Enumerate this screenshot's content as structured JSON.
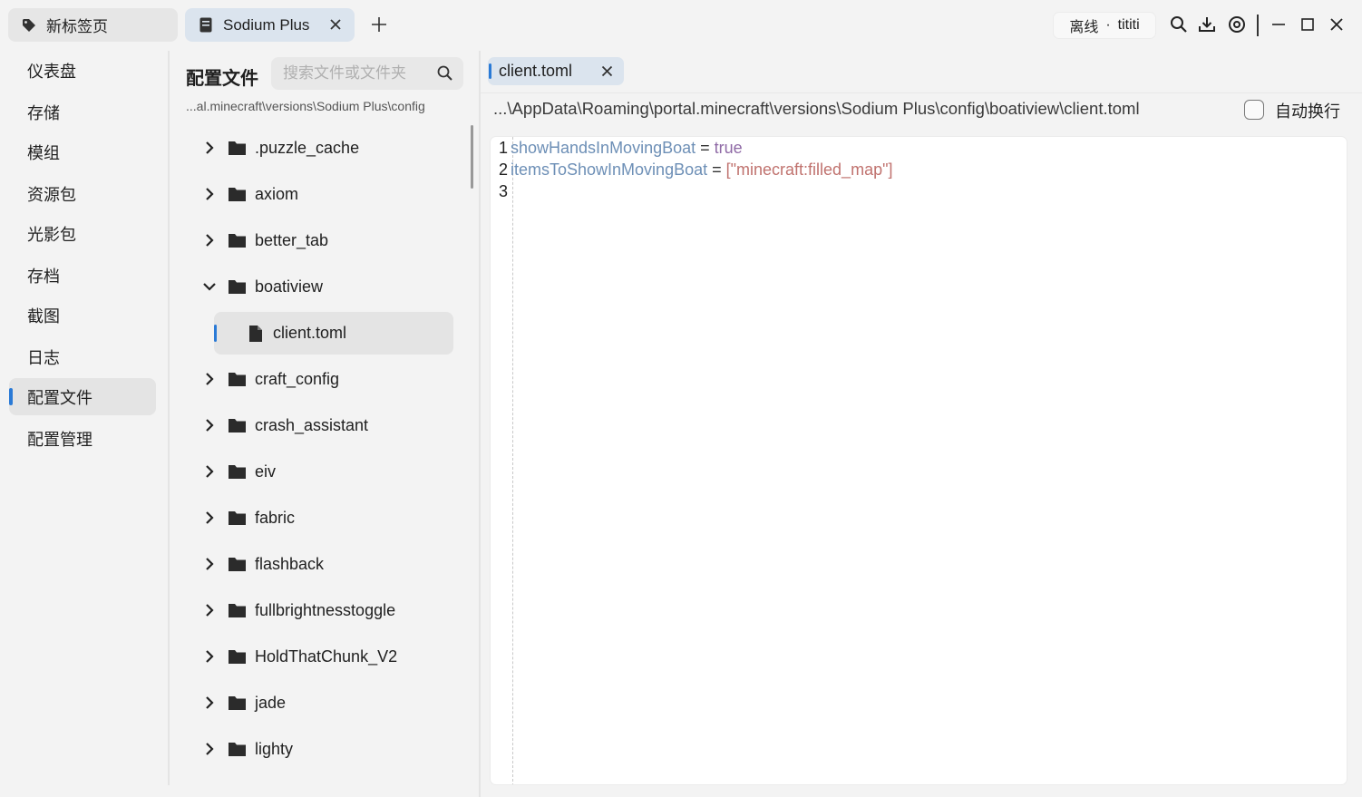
{
  "tabs": {
    "home_label": "新标签页",
    "active_label": "Sodium Plus"
  },
  "account": {
    "status": "离线",
    "dot": "·",
    "user": "tititi"
  },
  "sidebar": {
    "items": [
      {
        "label": "仪表盘"
      },
      {
        "label": "存储"
      },
      {
        "label": "模组"
      },
      {
        "label": "资源包"
      },
      {
        "label": "光影包"
      },
      {
        "label": "存档"
      },
      {
        "label": "截图"
      },
      {
        "label": "日志"
      },
      {
        "label": "配置文件",
        "active": true
      },
      {
        "label": "配置管理"
      }
    ]
  },
  "filepanel": {
    "title": "配置文件",
    "search_placeholder": "搜索文件或文件夹",
    "path": "...al.minecraft\\versions\\Sodium Plus\\config",
    "tree": [
      {
        "name": ".puzzle_cache",
        "expanded": false
      },
      {
        "name": "axiom",
        "expanded": false
      },
      {
        "name": "better_tab",
        "expanded": false
      },
      {
        "name": "boatiview",
        "expanded": true
      },
      {
        "name": "craft_config",
        "expanded": false
      },
      {
        "name": "crash_assistant",
        "expanded": false
      },
      {
        "name": "eiv",
        "expanded": false
      },
      {
        "name": "fabric",
        "expanded": false
      },
      {
        "name": "flashback",
        "expanded": false
      },
      {
        "name": "fullbrightnesstoggle",
        "expanded": false
      },
      {
        "name": "HoldThatChunk_V2",
        "expanded": false
      },
      {
        "name": "jade",
        "expanded": false
      },
      {
        "name": "lighty",
        "expanded": false
      }
    ],
    "selected_file": "client.toml"
  },
  "editor": {
    "tab_label": "client.toml",
    "path": "...\\AppData\\Roaming\\portal.minecraft\\versions\\Sodium Plus\\config\\boatiview\\client.toml",
    "wrap_label": "自动换行",
    "wrap_checked": false,
    "lines": [
      {
        "num": "1",
        "key": "showHandsInMovingBoat",
        "op": "=",
        "value": "true"
      },
      {
        "num": "2",
        "key": "itemsToShowInMovingBoat",
        "op": "=",
        "value": "[\"minecraft:filled_map\"]"
      },
      {
        "num": "3",
        "key": "",
        "op": "",
        "value": ""
      }
    ]
  },
  "colors": {
    "accent": "#2a7ad6",
    "active_tab_bg": "#dbe4ee",
    "key_color": "#6d8fb6",
    "bool_color": "#8f6aa6",
    "string_color": "#c0726e"
  }
}
